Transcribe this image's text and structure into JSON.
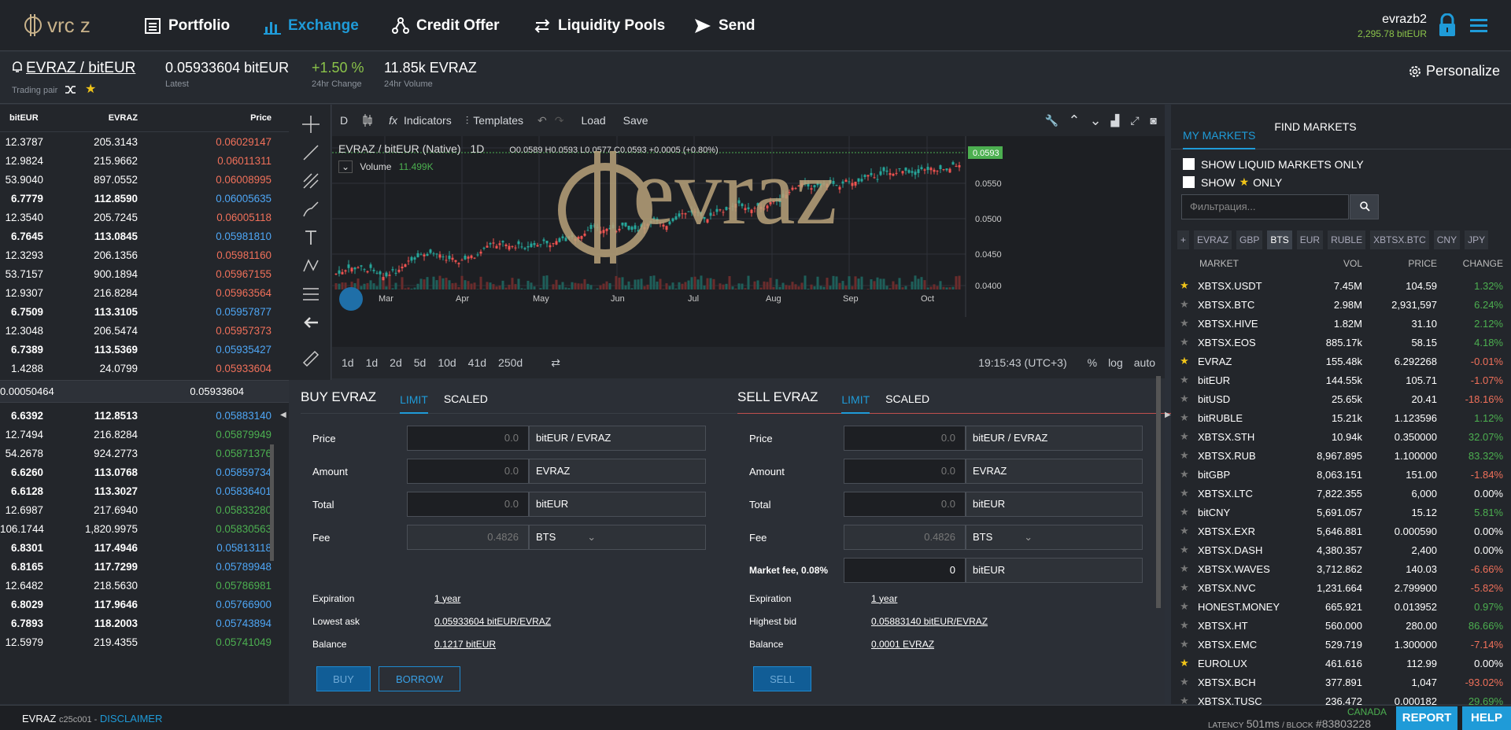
{
  "nav": {
    "portfolio": "Portfolio",
    "exchange": "Exchange",
    "credit": "Credit Offer",
    "pools": "Liquidity Pools",
    "send": "Send"
  },
  "account": {
    "name": "evrazb2",
    "balance": "2,295.78 bitEUR"
  },
  "market": {
    "base": "EVRAZ",
    "quote": "bitEUR",
    "sep": "/",
    "trading_pair_label": "Trading pair",
    "latest_value": "0.05933604 bitEUR",
    "latest_label": "Latest",
    "change_value": "+1.50 %",
    "change_label": "24hr Change",
    "volume_value": "11.85k EVRAZ",
    "volume_label": "24hr Volume",
    "personalize": "Personalize"
  },
  "orderbook": {
    "headers": [
      "bitEUR",
      "EVRAZ",
      "Price"
    ],
    "asks": [
      [
        "12.3787",
        "205.3143",
        "0.06029147",
        0
      ],
      [
        "12.9824",
        "215.9662",
        "0.06011311",
        0
      ],
      [
        "53.9040",
        "897.0552",
        "0.06008995",
        0
      ],
      [
        "6.7779",
        "112.8590",
        "0.06005635",
        1
      ],
      [
        "12.3540",
        "205.7245",
        "0.06005118",
        0
      ],
      [
        "6.7645",
        "113.0845",
        "0.05981810",
        1
      ],
      [
        "12.3293",
        "206.1356",
        "0.05981160",
        0
      ],
      [
        "53.7157",
        "900.1894",
        "0.05967155",
        0
      ],
      [
        "12.9307",
        "216.8284",
        "0.05963564",
        0
      ],
      [
        "6.7509",
        "113.3105",
        "0.05957877",
        1
      ],
      [
        "12.3048",
        "206.5474",
        "0.05957373",
        0
      ],
      [
        "6.7389",
        "113.5369",
        "0.05935427",
        1
      ],
      [
        "1.4288",
        "24.0799",
        "0.05933604",
        0
      ]
    ],
    "spread_left": "0.00050464",
    "spread_price": "0.05933604",
    "bids": [
      [
        "6.6392",
        "112.8513",
        "0.05883140",
        1
      ],
      [
        "12.7494",
        "216.8284",
        "0.05879949",
        0
      ],
      [
        "54.2678",
        "924.2773",
        "0.05871376",
        0
      ],
      [
        "6.6260",
        "113.0768",
        "0.05859734",
        1
      ],
      [
        "6.6128",
        "113.3027",
        "0.05836401",
        1
      ],
      [
        "12.6987",
        "217.6940",
        "0.05833280",
        0
      ],
      [
        "106.1744",
        "1,820.9975",
        "0.05830563",
        0
      ],
      [
        "6.8301",
        "117.4946",
        "0.05813118",
        1
      ],
      [
        "6.8165",
        "117.7299",
        "0.05789948",
        1
      ],
      [
        "12.6482",
        "218.5630",
        "0.05786981",
        0
      ],
      [
        "6.8029",
        "117.9646",
        "0.05766900",
        1
      ],
      [
        "6.7893",
        "118.2003",
        "0.05743894",
        1
      ],
      [
        "12.5979",
        "219.4355",
        "0.05741049",
        0
      ]
    ]
  },
  "chart": {
    "interval": "D",
    "indicators": "Indicators",
    "templates": "Templates",
    "load": "Load",
    "save": "Save",
    "legend_title": "EVRAZ / bitEUR (Native)",
    "legend_tf": "1D",
    "ohlc": "O0.0589 H0.0593 L0.0577 C0.0593 +0.0005 (+0.80%)",
    "volume_label": "Volume",
    "volume_value": "11.499K",
    "price_tag": "0.0593",
    "yticks": [
      "0.0550",
      "0.0500",
      "0.0450",
      "0.0400"
    ],
    "months": [
      "Mar",
      "Apr",
      "May",
      "Jun",
      "Jul",
      "Aug",
      "Sep",
      "Oct"
    ],
    "ranges": [
      "1d",
      "1d",
      "2d",
      "5d",
      "10d",
      "41d",
      "250d"
    ],
    "clock": "19:15:43 (UTC+3)",
    "pct": "%",
    "log": "log",
    "auto": "auto",
    "watermark": "evraz"
  },
  "buy": {
    "title": "BUY EVRAZ",
    "tab1": "LIMIT",
    "tab2": "SCALED",
    "price": "Price",
    "amount": "Amount",
    "total": "Total",
    "fee": "Fee",
    "zero": "0.0",
    "fee_value": "0.4826",
    "u_price": "bitEUR / EVRAZ",
    "u_amount": "EVRAZ",
    "u_total": "bitEUR",
    "u_fee": "BTS",
    "exp": "Expiration",
    "exp_v": "1 year",
    "low": "Lowest ask",
    "low_v": "0.05933604 bitEUR/EVRAZ",
    "bal": "Balance",
    "bal_v": "0.1217 bitEUR",
    "btn_buy": "BUY",
    "btn_borrow": "BORROW"
  },
  "sell": {
    "title": "SELL EVRAZ",
    "tab1": "LIMIT",
    "tab2": "SCALED",
    "price": "Price",
    "amount": "Amount",
    "total": "Total",
    "fee": "Fee",
    "zero": "0.0",
    "fee_value": "0.4826",
    "u_price": "bitEUR / EVRAZ",
    "u_amount": "EVRAZ",
    "u_total": "bitEUR",
    "u_fee": "BTS",
    "mfee": "Market fee, 0.08%",
    "mfee_v": "0",
    "u_mfee": "bitEUR",
    "exp": "Expiration",
    "exp_v": "1 year",
    "high": "Highest bid",
    "high_v": "0.05883140 bitEUR/EVRAZ",
    "bal": "Balance",
    "bal_v": "0.0001 EVRAZ",
    "btn_sell": "SELL"
  },
  "markets": {
    "tab_my": "MY MARKETS",
    "tab_find": "FIND MARKETS",
    "liquid": "SHOW LIQUID MARKETS ONLY",
    "show": "SHOW",
    "only": "ONLY",
    "filter": "Фильтрация...",
    "quotes": [
      "+",
      "EVRAZ",
      "GBP",
      "BTS",
      "EUR",
      "RUBLE",
      "XBTSX.BTC",
      "CNY",
      "JPY"
    ],
    "cols": [
      "MARKET",
      "VOL",
      "PRICE",
      "CHANGE"
    ],
    "rows": [
      [
        "XBTSX.USDT",
        "7.45M",
        "104.59",
        "1.32%",
        1,
        1
      ],
      [
        "XBTSX.BTC",
        "2.98M",
        "2,931,597",
        "6.24%",
        0,
        1
      ],
      [
        "XBTSX.HIVE",
        "1.82M",
        "31.10",
        "2.12%",
        0,
        1
      ],
      [
        "XBTSX.EOS",
        "885.17k",
        "58.15",
        "4.18%",
        0,
        1
      ],
      [
        "EVRAZ",
        "155.48k",
        "6.292268",
        "-0.01%",
        1,
        -1
      ],
      [
        "bitEUR",
        "144.55k",
        "105.71",
        "-1.07%",
        0,
        -1
      ],
      [
        "bitUSD",
        "25.65k",
        "20.41",
        "-18.16%",
        0,
        -1
      ],
      [
        "bitRUBLE",
        "15.21k",
        "1.123596",
        "1.12%",
        0,
        1
      ],
      [
        "XBTSX.STH",
        "10.94k",
        "0.350000",
        "32.07%",
        0,
        1
      ],
      [
        "XBTSX.RUB",
        "8,967.895",
        "1.100000",
        "83.32%",
        0,
        1
      ],
      [
        "bitGBP",
        "8,063.151",
        "151.00",
        "-1.84%",
        0,
        -1
      ],
      [
        "XBTSX.LTC",
        "7,822.355",
        "6,000",
        "0.00%",
        0,
        0
      ],
      [
        "bitCNY",
        "5,691.057",
        "15.12",
        "5.81%",
        0,
        1
      ],
      [
        "XBTSX.EXR",
        "5,646.881",
        "0.000590",
        "0.00%",
        0,
        0
      ],
      [
        "XBTSX.DASH",
        "4,380.357",
        "2,400",
        "0.00%",
        0,
        0
      ],
      [
        "XBTSX.WAVES",
        "3,712.862",
        "140.03",
        "-6.66%",
        0,
        -1
      ],
      [
        "XBTSX.NVC",
        "1,231.664",
        "2.799900",
        "-5.82%",
        0,
        -1
      ],
      [
        "HONEST.MONEY",
        "665.921",
        "0.013952",
        "0.97%",
        0,
        1
      ],
      [
        "XBTSX.HT",
        "560.000",
        "280.00",
        "86.66%",
        0,
        1
      ],
      [
        "XBTSX.EMC",
        "529.719",
        "1.300000",
        "-7.14%",
        0,
        -1
      ],
      [
        "EUROLUX",
        "461.616",
        "112.99",
        "0.00%",
        1,
        0
      ],
      [
        "XBTSX.BCH",
        "377.891",
        "1,047",
        "-93.02%",
        0,
        -1
      ],
      [
        "XBTSX.TUSC",
        "236.472",
        "0.000182",
        "29.69%",
        0,
        1
      ]
    ]
  },
  "footer": {
    "app": "EVRAZ",
    "build": "c25c001 -",
    "disclaimer": "DISCLAIMER",
    "region": "CANADA",
    "latency_label": "LATENCY",
    "latency": "501ms",
    "block_label": "/ BLOCK",
    "block": "#83803228",
    "report": "REPORT",
    "help": "HELP"
  },
  "colors": {
    "accent": "#1f9bd8",
    "up": "#4caf50",
    "down": "#f0705a",
    "green": "#8bc34a"
  }
}
